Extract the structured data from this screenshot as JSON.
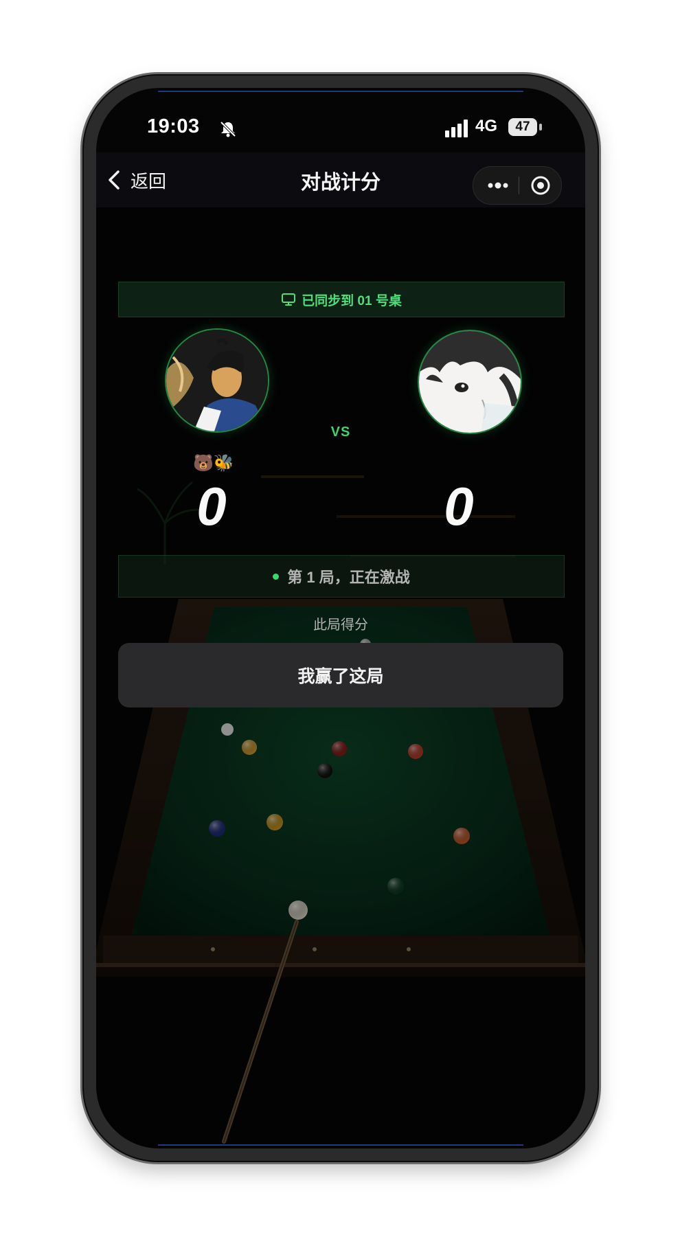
{
  "status_bar": {
    "time": "19:03",
    "network": "4G",
    "battery": "47"
  },
  "nav": {
    "back_label": "返回",
    "title": "对战计分"
  },
  "sync_banner": {
    "text": "已同步到 01 号桌"
  },
  "players": {
    "left": {
      "badges": "🐻🐝",
      "score": "0"
    },
    "right": {
      "score": "0"
    }
  },
  "vs_label": "VS",
  "round": {
    "status_text": "第 1 局，正在激战",
    "score_label": "此局得分",
    "win_button_label": "我赢了这局"
  },
  "colors": {
    "accent_green": "#3dd66c",
    "button_bg": "#2a2a2c",
    "screen_bg": "#050505"
  },
  "icons": {
    "bell": "bell-off-icon",
    "signal": "cellular-signal-icon",
    "back": "chevron-left-icon",
    "more": "more-dots-icon",
    "close": "target-close-icon",
    "sync": "monitor-icon"
  }
}
